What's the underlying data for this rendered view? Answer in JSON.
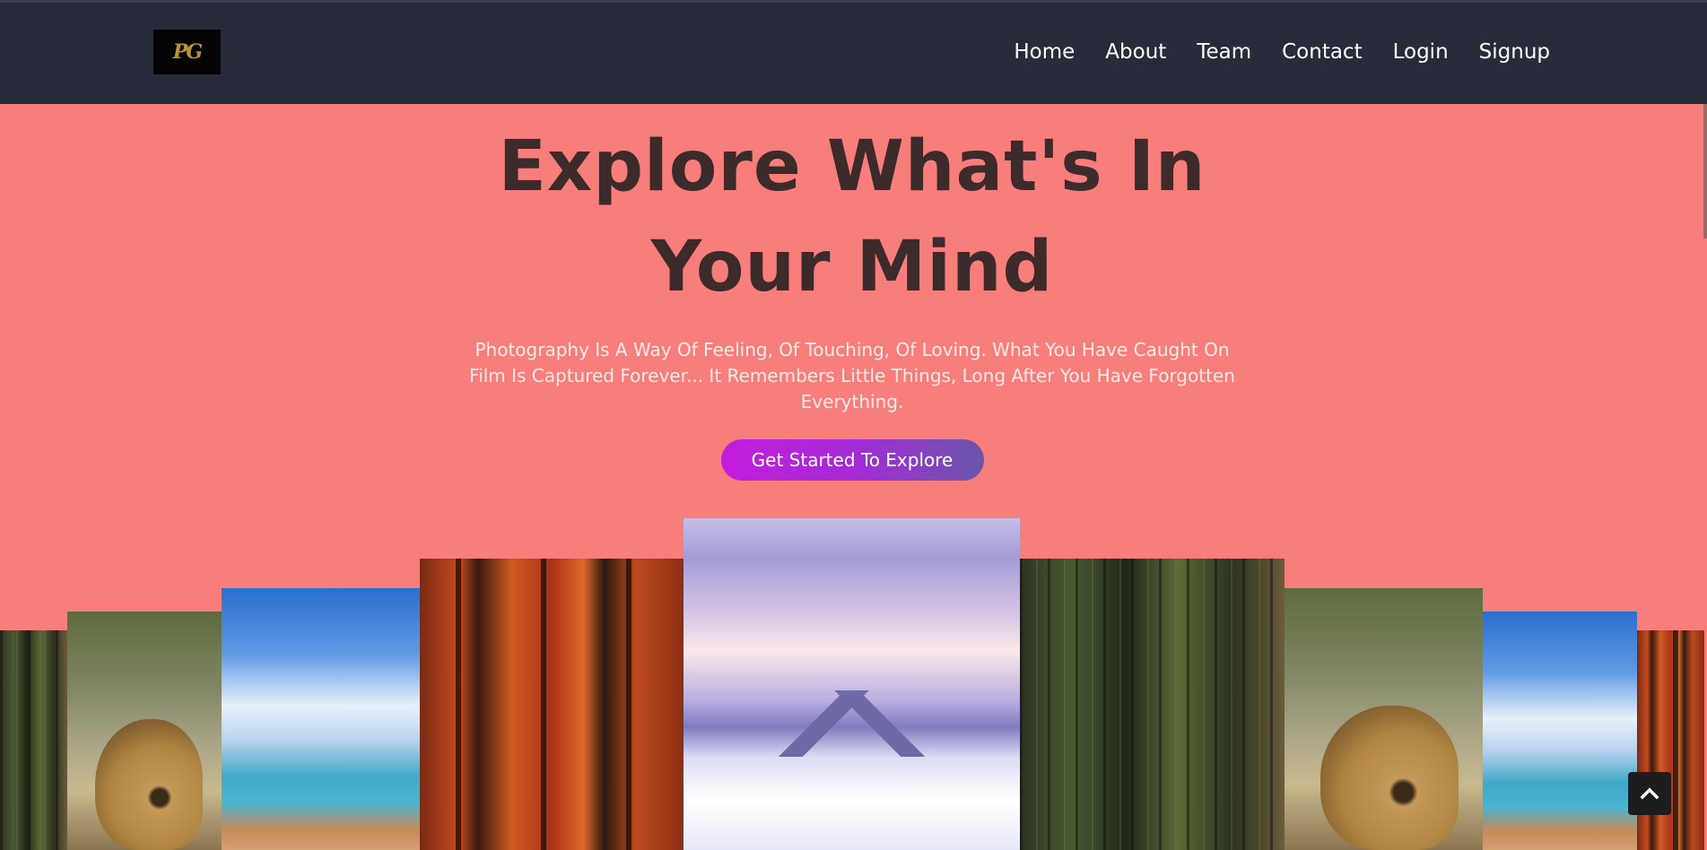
{
  "header": {
    "logo_text": "PG",
    "nav": [
      "Home",
      "About",
      "Team",
      "Contact",
      "Login",
      "Signup"
    ]
  },
  "hero": {
    "title": "Explore What's In Your Mind",
    "subtitle": "Photography Is A Way Of Feeling, Of Touching, Of Loving. What You Have Caught On Film Is Captured Forever... It Remembers Little Things, Long After You Have Forgotten Everything.",
    "cta_label": "Get Started To Explore"
  },
  "gallery": {
    "photos": [
      "forest",
      "dog",
      "beach",
      "autumn-forest",
      "snow-mountains",
      "forest",
      "dog",
      "beach",
      "autumn-forest"
    ]
  },
  "icons": {
    "back_to_top": "chevron-up-icon"
  },
  "colors": {
    "header_bg": "#272b3a",
    "hero_bg": "#f77e7b",
    "title": "#3d2b2c",
    "cta_start": "#c41ddb",
    "cta_end": "#6a56a8"
  }
}
